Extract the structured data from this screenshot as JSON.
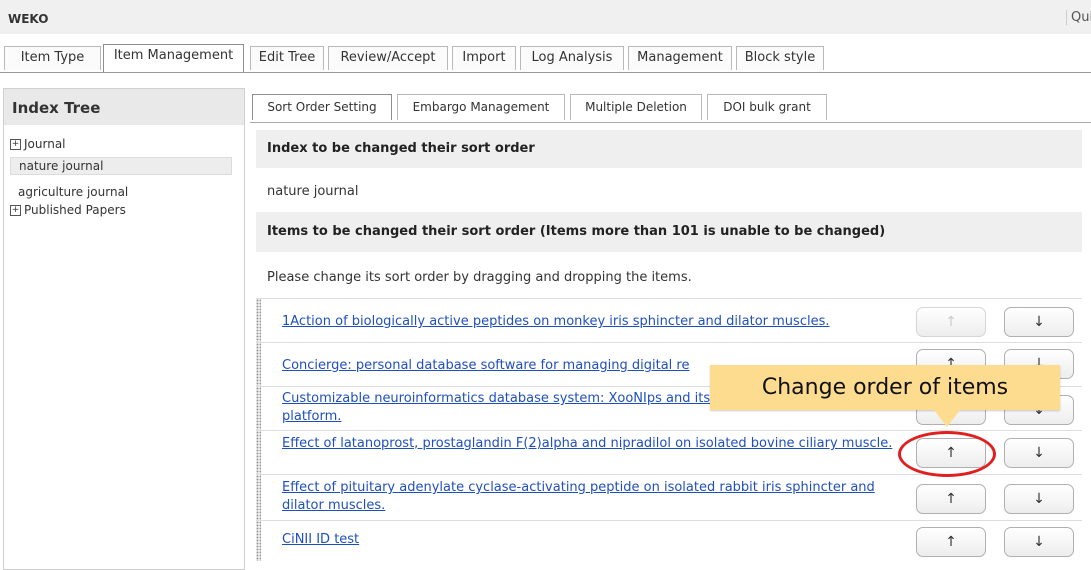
{
  "app": {
    "title": "WEKO",
    "quick_link": "Qui"
  },
  "main_tabs": [
    {
      "label": "Item Type"
    },
    {
      "label": "Item Management"
    },
    {
      "label": "Edit Tree"
    },
    {
      "label": "Review/Accept"
    },
    {
      "label": "Import"
    },
    {
      "label": "Log Analysis"
    },
    {
      "label": "Management"
    },
    {
      "label": "Block style"
    }
  ],
  "index_tree": {
    "title": "Index Tree",
    "toggle_symbol": "+",
    "nodes": [
      {
        "label": "Journal"
      },
      {
        "label": "nature journal"
      },
      {
        "label": "agriculture journal"
      },
      {
        "label": "Published Papers"
      }
    ]
  },
  "sub_tabs": [
    {
      "label": "Sort Order Setting"
    },
    {
      "label": "Embargo Management"
    },
    {
      "label": "Multiple Deletion"
    },
    {
      "label": "DOI bulk grant"
    }
  ],
  "sort_setting": {
    "index_heading": "Index to be changed their sort order",
    "index_value": "nature journal",
    "items_heading": "Items to be changed their sort order (Items more than 101 is unable to be changed)",
    "instruction": "Please change its sort order by dragging and dropping the items.",
    "up_symbol": "↑",
    "down_symbol": "↓",
    "items": [
      {
        "title": "1Action of biologically active peptides on monkey iris sphincter and dilator muscles.",
        "up_enabled": false
      },
      {
        "title": "Concierge: personal database software for managing digital re",
        "up_enabled": true
      },
      {
        "title": "Customizable neuroinformatics database system: XooNIps and its application to the pupil platform.",
        "up_enabled": true
      },
      {
        "title": "Effect of latanoprost, prostaglandin F(2)alpha and nipradilol on isolated bovine ciliary muscle.",
        "up_enabled": true
      },
      {
        "title": "Effect of pituitary adenylate cyclase-activating peptide on isolated rabbit iris sphincter and dilator muscles.",
        "up_enabled": true
      },
      {
        "title": "CiNII ID test",
        "up_enabled": true
      }
    ]
  },
  "annotation": {
    "callout_text": "Change order of items"
  }
}
